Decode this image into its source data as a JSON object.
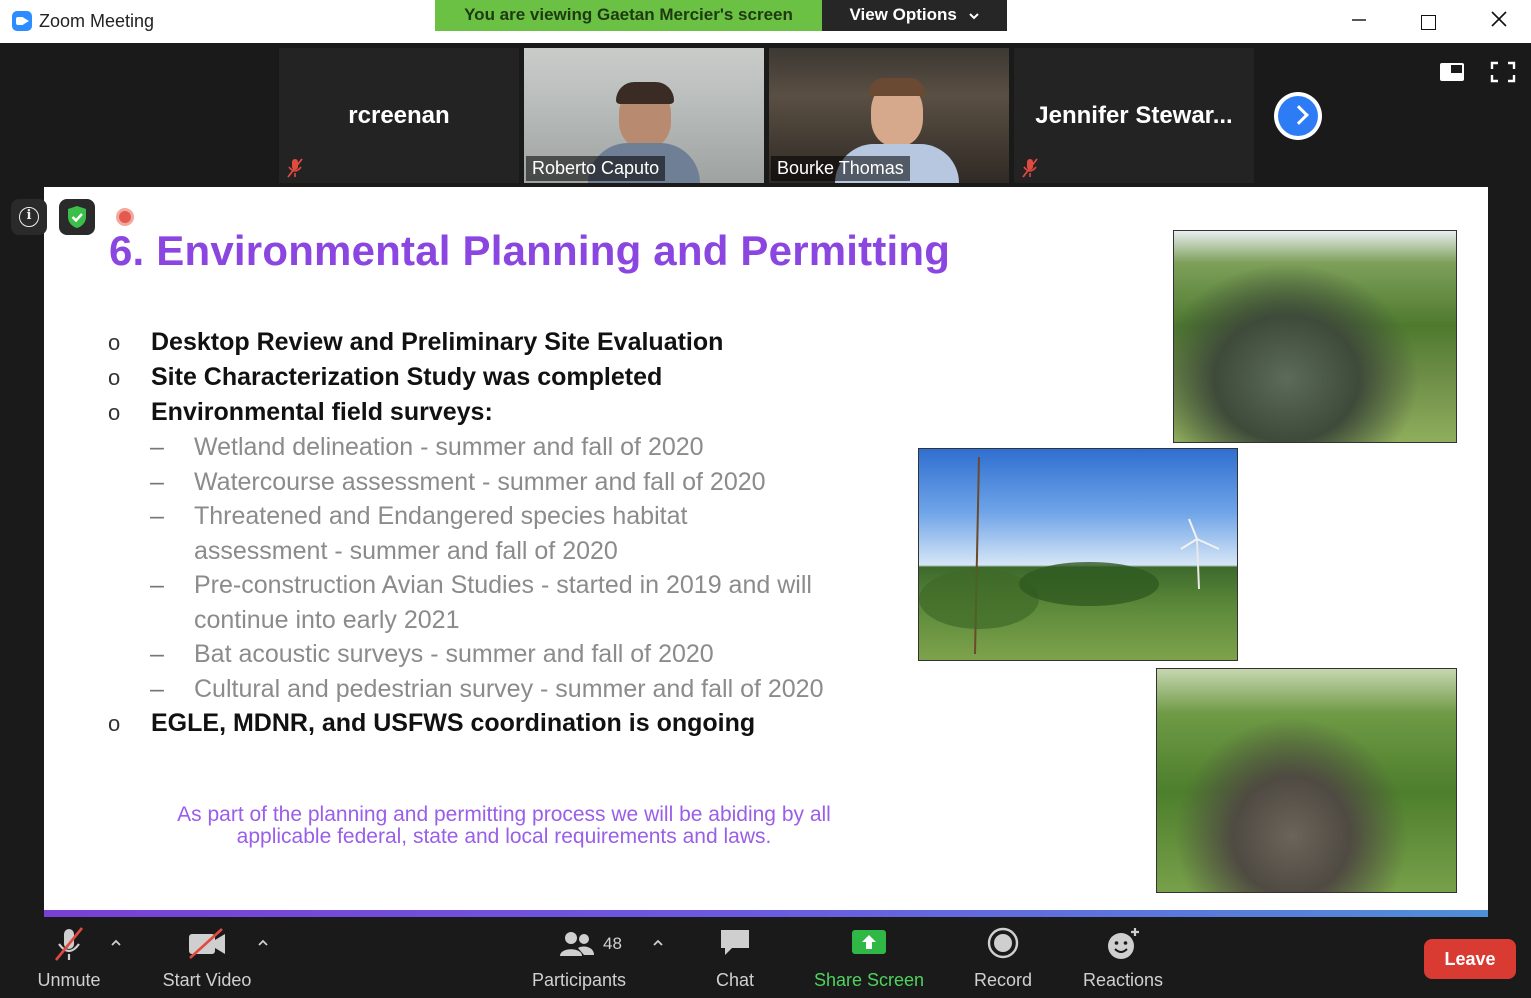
{
  "window": {
    "title": "Zoom Meeting",
    "viewing_banner": "You are viewing Gaetan Mercier's screen",
    "view_options": "View Options"
  },
  "participants_strip": [
    {
      "name": "rcreenan",
      "video": false,
      "muted": true
    },
    {
      "name": "Roberto Caputo",
      "video": true,
      "muted": false
    },
    {
      "name": "Bourke Thomas",
      "video": true,
      "muted": false
    },
    {
      "name": "Jennifer  Stewar...",
      "video": false,
      "muted": true
    }
  ],
  "slide": {
    "title": "6. Environmental Planning and Permitting",
    "bullets": [
      {
        "level": 1,
        "marker": "o",
        "text": "Desktop Review and Preliminary Site Evaluation"
      },
      {
        "level": 1,
        "marker": "o",
        "text": "Site Characterization Study was completed"
      },
      {
        "level": 1,
        "marker": "o",
        "text": "Environmental field surveys:"
      },
      {
        "level": 2,
        "marker": "–",
        "text": "Wetland delineation - summer and fall of 2020"
      },
      {
        "level": 2,
        "marker": "–",
        "text": "Watercourse assessment - summer and fall of 2020"
      },
      {
        "level": 2,
        "marker": "–",
        "text": "Threatened and Endangered species habitat assessment - summer and fall of 2020"
      },
      {
        "level": 2,
        "marker": "–",
        "text": "Pre-construction Avian Studies - started in 2019 and will continue into early 2021"
      },
      {
        "level": 2,
        "marker": "–",
        "text": "Bat acoustic surveys - summer and fall of 2020"
      },
      {
        "level": 2,
        "marker": "–",
        "text": "Cultural and pedestrian survey - summer and fall of 2020"
      },
      {
        "level": 1,
        "marker": "o",
        "text": "EGLE, MDNR, and USFWS coordination is ongoing"
      }
    ],
    "footnote_line1": "As part of the planning and permitting process  we will be abiding by all",
    "footnote_line2": "applicable federal, state and local requirements and laws."
  },
  "toolbar": {
    "unmute": "Unmute",
    "start_video": "Start Video",
    "participants": "Participants",
    "participant_count": "48",
    "chat": "Chat",
    "share_screen": "Share Screen",
    "record": "Record",
    "reactions": "Reactions",
    "leave": "Leave"
  },
  "colors": {
    "banner_green": "#6ac144",
    "slide_title_purple": "#8b45e0",
    "share_green": "#2fb846",
    "leave_red": "#d93a32",
    "next_blue": "#2d7cf6"
  }
}
